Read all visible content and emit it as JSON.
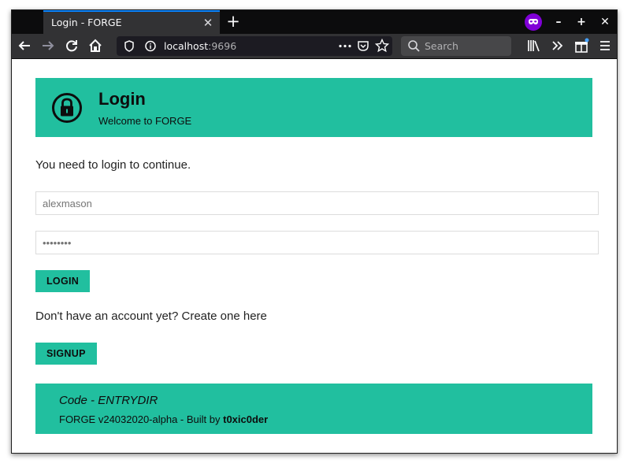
{
  "browser": {
    "tab_title": "Login - FORGE",
    "tab_close": "✕",
    "new_tab": "+",
    "url_host": "localhost",
    "url_port": ":9696",
    "search_placeholder": "Search",
    "window_controls": {
      "minimize": "–",
      "maximize": "+",
      "close": "✕"
    },
    "accent_color": "#0a84ff"
  },
  "header": {
    "title": "Login",
    "subtitle": "Welcome to FORGE",
    "icon": "lock-icon"
  },
  "main": {
    "message": "You need to login to continue.",
    "username_value": "alexmason",
    "password_value": "••••••••",
    "login_label": "LOGIN",
    "signup_prompt": "Don't have an account yet? Create one here",
    "signup_label": "SIGNUP"
  },
  "footer": {
    "code": "Code - ENTRYDIR",
    "version_text": "FORGE v24032020-alpha - Built by ",
    "author": "t0xic0der"
  },
  "colors": {
    "brand": "#21bf9f",
    "text": "#0d0d0d"
  }
}
